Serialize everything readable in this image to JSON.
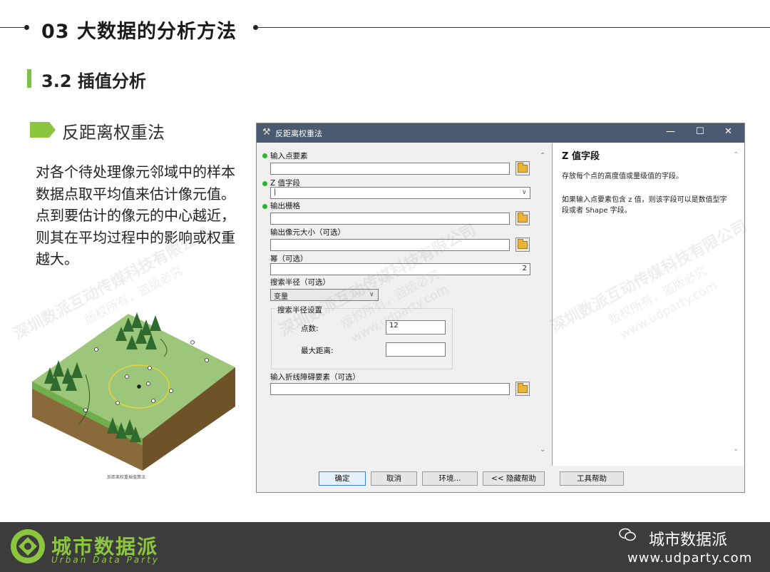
{
  "header": {
    "title": "03 大数据的分析方法"
  },
  "subheader": {
    "title": "3.2 插值分析"
  },
  "section": {
    "tag": "反距离权重法",
    "body": "对各个待处理像元邻域中的样本数据点取平均值来估计像元值。点到要估计的像元的中心越近，则其在平均过程中的影响或权重越大。"
  },
  "illustration": {
    "caption": "反距离权重插值算法"
  },
  "dialog": {
    "title": "反距离权重法",
    "fields": {
      "input_points_label": "输入点要素",
      "z_field_label": "Z 值字段",
      "output_raster_label": "输出栅格",
      "cell_size_label": "输出像元大小（可选）",
      "power_label": "幂（可选）",
      "power_value": "2",
      "search_radius_label": "搜索半径（可选）",
      "search_radius_value": "变量",
      "search_settings_label": "搜索半径设置",
      "points_label": "点数:",
      "points_value": "12",
      "max_distance_label": "最大距离:",
      "barrier_label": "输入折线障碍要素（可选）"
    },
    "buttons": {
      "ok": "确定",
      "cancel": "取消",
      "env": "环境...",
      "hide_help": "<< 隐藏帮助",
      "tool_help": "工具帮助"
    },
    "help": {
      "title": "Z 值字段",
      "p1": "存放每个点的高度值或量级值的字段。",
      "p2": "如果输入点要素包含 z 值，则该字段可以是数值型字段或者 Shape 字段。"
    }
  },
  "watermark": {
    "line1": "深圳数派互动传媒科技有限公司",
    "line2": "版权所有，盗版必究",
    "line3": "www.udparty.com"
  },
  "footer": {
    "brand_cn": "城市数据派",
    "brand_en": "Urban Data Party",
    "name": "城市数据派",
    "url": "www.udparty.com"
  },
  "colors": {
    "accent": "#8cc63f",
    "titlebar": "#4a5a70",
    "footer_bg": "#3c3c3c"
  }
}
